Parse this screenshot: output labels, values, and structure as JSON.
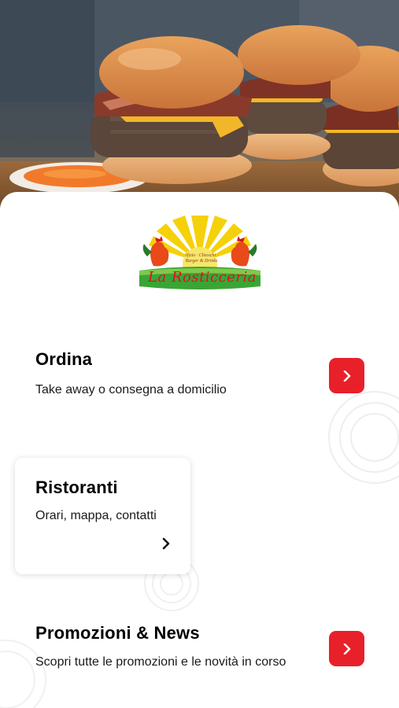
{
  "hero": {
    "image": "burger-photo"
  },
  "logo": {
    "brand": "La Rosticceria",
    "tagline": "Sfizio · Chioschi · Burger & Drinks"
  },
  "menu": {
    "ordina": {
      "title": "Ordina",
      "subtitle": "Take away o consegna a domicilio"
    },
    "ristoranti": {
      "title": "Ristoranti",
      "subtitle": "Orari, mappa, contatti"
    },
    "promo": {
      "title": "Promozioni & News",
      "subtitle": "Scopri tutte le promozioni e le novità in corso"
    }
  },
  "colors": {
    "accent": "#e8202a",
    "logo_yellow": "#f5d10a",
    "logo_green": "#3aa535"
  },
  "icons": {
    "arrow": "chevron-right-icon"
  }
}
